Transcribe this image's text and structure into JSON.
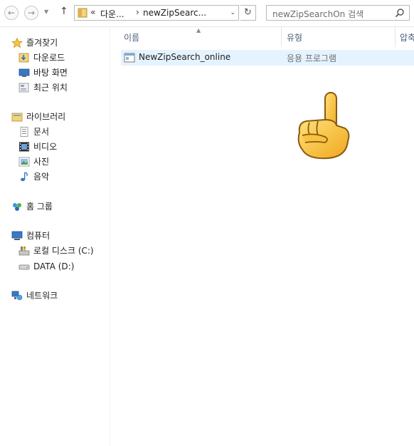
{
  "toolbar": {
    "back_glyph": "←",
    "forward_glyph": "→",
    "recent_glyph": "▼",
    "up_glyph": "↑",
    "address": {
      "overflow_glyph": "«",
      "crumbs": [
        "다운...",
        "newZipSearc..."
      ],
      "separator_glyph": "›",
      "dropdown_glyph": "⌄"
    },
    "refresh_glyph": "↻",
    "search": {
      "placeholder": "newZipSearchOn 검색"
    }
  },
  "navigation": {
    "favorites": {
      "label": "즐겨찾기",
      "icon": "star-icon",
      "items": [
        {
          "label": "다운로드",
          "icon": "downloads-folder-icon"
        },
        {
          "label": "바탕 화면",
          "icon": "desktop-icon"
        },
        {
          "label": "최근 위치",
          "icon": "recent-places-icon"
        }
      ]
    },
    "libraries": {
      "label": "라이브러리",
      "icon": "library-icon",
      "items": [
        {
          "label": "문서",
          "icon": "documents-icon"
        },
        {
          "label": "비디오",
          "icon": "videos-icon"
        },
        {
          "label": "사진",
          "icon": "pictures-icon"
        },
        {
          "label": "음악",
          "icon": "music-icon"
        }
      ]
    },
    "homegroup": {
      "label": "홈 그룹",
      "icon": "homegroup-icon"
    },
    "computer": {
      "label": "컴퓨터",
      "icon": "computer-icon",
      "items": [
        {
          "label": "로컬 디스크 (C:)",
          "icon": "system-drive-icon"
        },
        {
          "label": "DATA (D:)",
          "icon": "drive-icon"
        }
      ]
    },
    "network": {
      "label": "네트워크",
      "icon": "network-icon"
    }
  },
  "content": {
    "columns": [
      {
        "label": "이름"
      },
      {
        "label": "유형"
      },
      {
        "label": "압축"
      }
    ],
    "files": [
      {
        "name": "NewZipSearch_online",
        "type": "응용 프로그램",
        "icon": "application-icon"
      }
    ],
    "pointer": "pointing-hand-icon"
  },
  "colors": {
    "selection": "#cde8ff",
    "row_hover": "#e5f3ff",
    "header_text": "#4c607a",
    "folder_yellow": "#e8b84a"
  }
}
